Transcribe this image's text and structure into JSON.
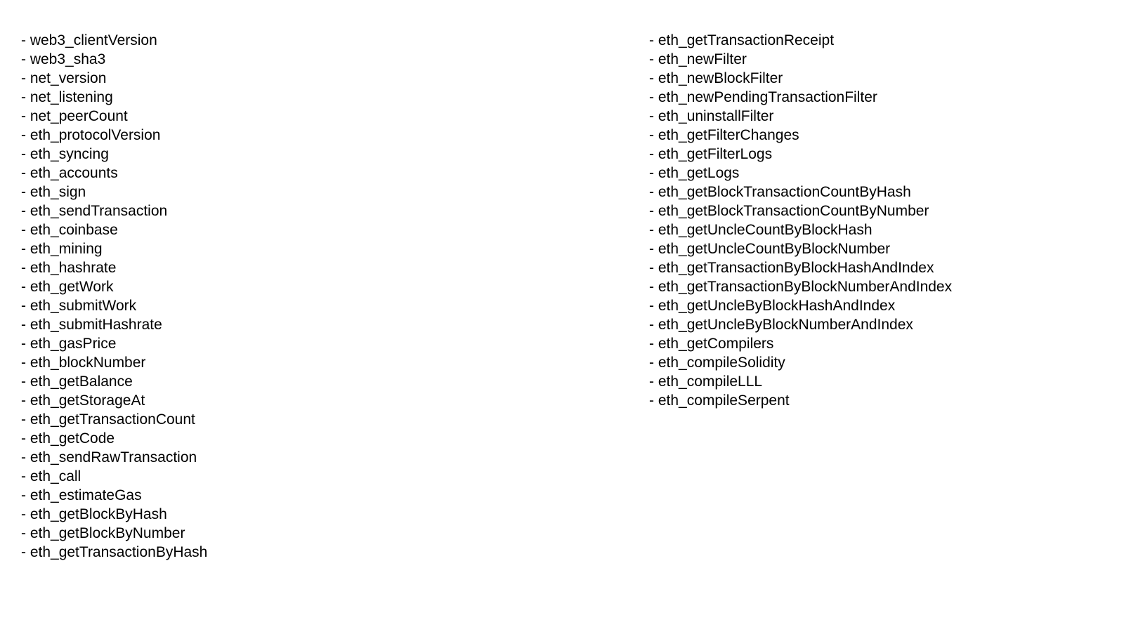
{
  "left_column": [
    "web3_clientVersion",
    "web3_sha3",
    "net_version",
    "net_listening",
    "net_peerCount",
    "eth_protocolVersion",
    "eth_syncing",
    "eth_accounts",
    "eth_sign",
    "eth_sendTransaction",
    "eth_coinbase",
    "eth_mining",
    "eth_hashrate",
    "eth_getWork",
    "eth_submitWork",
    "eth_submitHashrate",
    "eth_gasPrice",
    "eth_blockNumber",
    "eth_getBalance",
    "eth_getStorageAt",
    "eth_getTransactionCount",
    "eth_getCode",
    "eth_sendRawTransaction",
    "eth_call",
    "eth_estimateGas",
    "eth_getBlockByHash",
    "eth_getBlockByNumber",
    "eth_getTransactionByHash"
  ],
  "right_column": [
    "eth_getTransactionReceipt",
    "eth_newFilter",
    "eth_newBlockFilter",
    "eth_newPendingTransactionFilter",
    "eth_uninstallFilter",
    "eth_getFilterChanges",
    "eth_getFilterLogs",
    "eth_getLogs",
    "eth_getBlockTransactionCountByHash",
    "eth_getBlockTransactionCountByNumber",
    "eth_getUncleCountByBlockHash",
    "eth_getUncleCountByBlockNumber",
    "eth_getTransactionByBlockHashAndIndex",
    "eth_getTransactionByBlockNumberAndIndex",
    "eth_getUncleByBlockHashAndIndex",
    "eth_getUncleByBlockNumberAndIndex",
    "eth_getCompilers",
    "eth_compileSolidity",
    "eth_compileLLL",
    "eth_compileSerpent"
  ]
}
